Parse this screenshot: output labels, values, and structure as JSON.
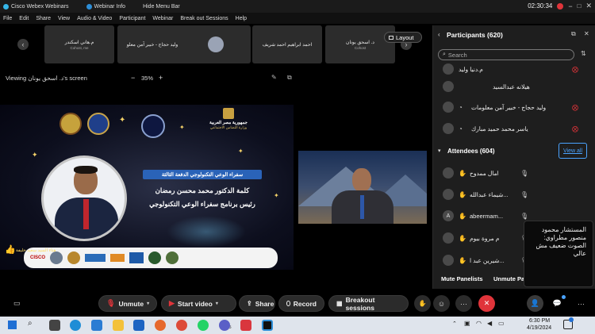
{
  "titlebar": {
    "app_title": "Cisco Webex Webinars",
    "info_tab": "Webinar Info",
    "hide_menu": "Hide Menu Bar",
    "timer": "02:30:34"
  },
  "menu": [
    "File",
    "Edit",
    "Share",
    "View",
    "Audio & Video",
    "Participant",
    "Webinar",
    "Break out Sessions",
    "Help"
  ],
  "filmstrip": {
    "tiles": [
      {
        "name": "م.هاني اسكندر",
        "sub": "Cohost, me"
      },
      {
        "name": "وليد حجاج - خبير آمن معلو",
        "sub": ""
      },
      {
        "name": "",
        "sub": ""
      },
      {
        "name": "احمد ابراهيم احمد شريف",
        "sub": ""
      },
      {
        "name": "د. اسحق يونان",
        "sub": "Cohost"
      }
    ],
    "layout_label": "Layout"
  },
  "viewer": {
    "viewing_label": "Viewing د. اسحق يونان's screen",
    "zoom": "35%"
  },
  "slide": {
    "top_line": "جمهورية مصر العربية",
    "ministry": "وزارة التضامن الاجتماعي",
    "program_tag": "سفراء الوعي التكنولوجي  الدفعة الثالثة",
    "headline1": "كلمة الدكتور محمد محسن رمضان",
    "headline2": "رئيس برنامج سفراء الوعي التكنولوجي",
    "footer": "هناء السيد سعيد خليفة",
    "footer_brand": "CISCO"
  },
  "panel": {
    "title": "Participants (620)",
    "search_placeholder": "Search",
    "participants": [
      "م.دنيا وليد",
      "هيلانه عبدالسيد",
      "وليد حجاج - خبير آمن معلومات",
      "ياسر محمد حميد مبارك"
    ],
    "attendees_title": "Attendees (604)",
    "view_all": "View all",
    "attendees": [
      {
        "name": "امال ممدوح",
        "initial": ""
      },
      {
        "name": "شيماء عبدالله...",
        "initial": ""
      },
      {
        "name": "abeermam...",
        "initial": "A"
      },
      {
        "name": "م مروة بيوم",
        "initial": ""
      },
      {
        "name": "شيرين عبد ا...",
        "initial": ""
      }
    ],
    "mute_panelists": "Mute Panelists",
    "mute_all": "Unmute Pa"
  },
  "tooltip": {
    "text": "المستشار محمود منصور مطراوي: الصوت ضعيف مش عالي"
  },
  "controls": {
    "unmute": "Unmute",
    "start_video": "Start video",
    "share": "Share",
    "record": "Record",
    "breakout": "Breakout sessions"
  },
  "taskbar": {
    "time": "6:30 PM",
    "date": "4/19/2024",
    "badge": "15"
  },
  "colors": {
    "accent_blue": "#4aa3ff",
    "mute_red": "#e0343a",
    "end_red": "#e0343a"
  }
}
